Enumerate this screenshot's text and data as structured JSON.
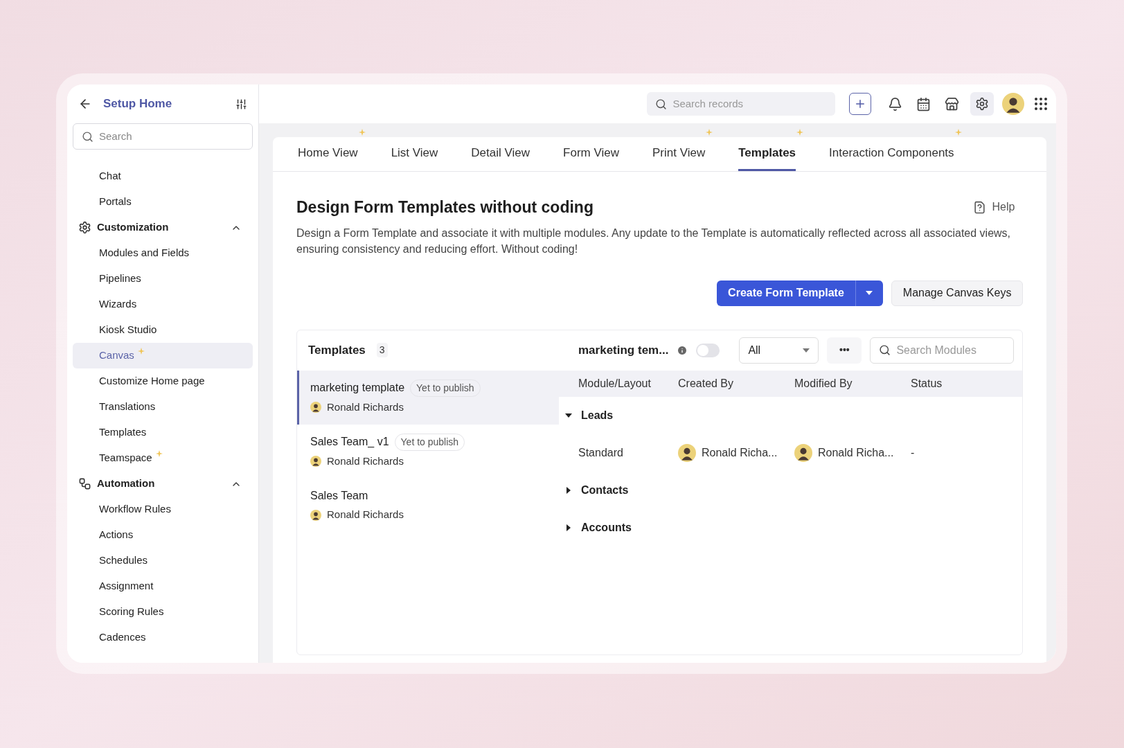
{
  "sidebar": {
    "title": "Setup Home",
    "search": {
      "placeholder": "Search"
    },
    "items": [
      {
        "kind": "item",
        "label": "Chat",
        "selected": false,
        "new": false
      },
      {
        "kind": "item",
        "label": "Portals",
        "selected": false,
        "new": false
      },
      {
        "kind": "section",
        "label": "Customization",
        "expanded": true,
        "children": [
          {
            "kind": "item",
            "label": "Modules and Fields",
            "selected": false,
            "new": false
          },
          {
            "kind": "item",
            "label": "Pipelines",
            "selected": false,
            "new": false
          },
          {
            "kind": "item",
            "label": "Wizards",
            "selected": false,
            "new": false
          },
          {
            "kind": "item",
            "label": "Kiosk Studio",
            "selected": false,
            "new": false
          },
          {
            "kind": "item",
            "label": "Canvas",
            "selected": true,
            "new": true
          },
          {
            "kind": "item",
            "label": "Customize Home page",
            "selected": false,
            "new": false
          },
          {
            "kind": "item",
            "label": "Translations",
            "selected": false,
            "new": false
          },
          {
            "kind": "item",
            "label": "Templates",
            "selected": false,
            "new": false
          },
          {
            "kind": "item",
            "label": "Teamspace",
            "selected": false,
            "new": true
          }
        ]
      },
      {
        "kind": "section",
        "label": "Automation",
        "expanded": true,
        "children": [
          {
            "kind": "item",
            "label": "Workflow Rules",
            "selected": false,
            "new": false
          },
          {
            "kind": "item",
            "label": "Actions",
            "selected": false,
            "new": false
          },
          {
            "kind": "item",
            "label": "Schedules",
            "selected": false,
            "new": false
          },
          {
            "kind": "item",
            "label": "Assignment",
            "selected": false,
            "new": false
          },
          {
            "kind": "item",
            "label": "Scoring Rules",
            "selected": false,
            "new": false
          },
          {
            "kind": "item",
            "label": "Cadences",
            "selected": false,
            "new": false
          }
        ]
      }
    ]
  },
  "topbar": {
    "search": {
      "placeholder": "Search records"
    }
  },
  "tabs": [
    {
      "label": "Home View",
      "selected": false,
      "new": true
    },
    {
      "label": "List View",
      "selected": false,
      "new": false
    },
    {
      "label": "Detail View",
      "selected": false,
      "new": false
    },
    {
      "label": "Form View",
      "selected": false,
      "new": false
    },
    {
      "label": "Print View",
      "selected": false,
      "new": true
    },
    {
      "label": "Templates",
      "selected": true,
      "new": true
    },
    {
      "label": "Interaction Components",
      "selected": false,
      "new": true
    }
  ],
  "content": {
    "heading": "Design Form Templates without coding",
    "help": "Help",
    "description": "Design a Form Template and associate it with multiple modules. Any update to the Template is automatically reflected across all associated views, ensuring consistency and reducing effort. Without coding!",
    "primary_button": "Create Form Template",
    "secondary_button": "Manage Canvas Keys"
  },
  "templates": {
    "title": "Templates",
    "count": "3",
    "items": [
      {
        "name": "marketing template",
        "badge": "Yet to publish",
        "author": "Ronald Richards",
        "selected": true
      },
      {
        "name": "Sales Team_ v1",
        "badge": "Yet to publish",
        "author": "Ronald Richards",
        "selected": false
      },
      {
        "name": "Sales Team",
        "author": "Ronald Richards",
        "selected": false
      }
    ]
  },
  "detail": {
    "name": "marketing tem...",
    "toggle": {
      "on": false
    },
    "filter": "All",
    "more": "•••",
    "search": {
      "placeholder": "Search Modules"
    },
    "columns": [
      "Module/Layout",
      "Created By",
      "Modified By",
      "Status"
    ],
    "groups": [
      {
        "name": "Leads",
        "expanded": true,
        "rows": [
          {
            "layout": "Standard",
            "created_by": "Ronald Richa...",
            "modified_by": "Ronald Richa...",
            "status": "-"
          }
        ]
      },
      {
        "name": "Contacts",
        "expanded": false
      },
      {
        "name": "Accounts",
        "expanded": false
      }
    ]
  }
}
